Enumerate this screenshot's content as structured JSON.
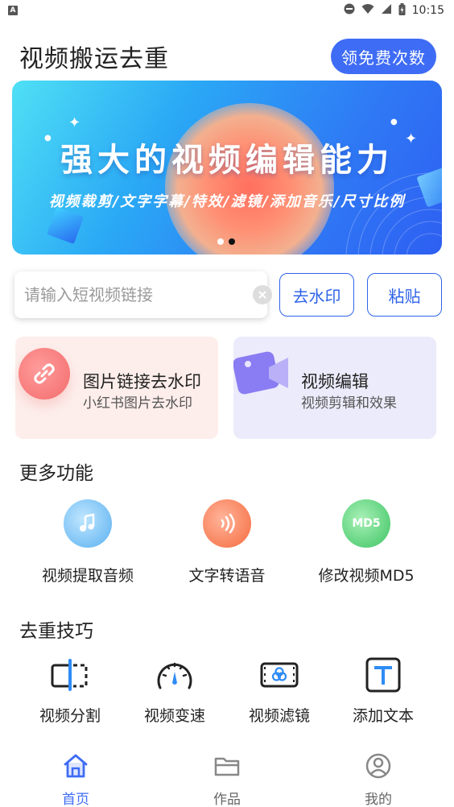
{
  "status_bar": {
    "left_icon": "A",
    "time": "10:15",
    "icons": [
      "dnd-icon",
      "wifi-icon",
      "signal-icon",
      "battery-icon"
    ]
  },
  "header": {
    "title": "视频搬运去重",
    "free_button": "领免费次数"
  },
  "banner": {
    "title": "强大的视频编辑能力",
    "subtitle": "视频裁剪/文字字幕/特效/滤镜/添加音乐/尺寸比例",
    "page_count": 2,
    "active_page": 2
  },
  "search": {
    "placeholder": "请输入短视频链接",
    "value": "",
    "watermark_button": "去水印",
    "paste_button": "粘贴"
  },
  "feature_cards": [
    {
      "title": "图片链接去水印",
      "subtitle": "小红书图片去水印",
      "icon": "link-icon"
    },
    {
      "title": "视频编辑",
      "subtitle": "视频剪辑和效果",
      "icon": "video-folder-icon"
    }
  ],
  "more_section": {
    "title": "更多功能",
    "items": [
      {
        "label": "视频提取音频",
        "icon": "music-icon"
      },
      {
        "label": "文字转语音",
        "icon": "sound-wave-icon"
      },
      {
        "label": "修改视频MD5",
        "icon": "md5-icon",
        "icon_text": "MD5"
      }
    ]
  },
  "tips_section": {
    "title": "去重技巧",
    "items": [
      {
        "label": "视频分割",
        "icon": "split-icon"
      },
      {
        "label": "视频变速",
        "icon": "speed-gauge-icon"
      },
      {
        "label": "视频滤镜",
        "icon": "filter-icon"
      },
      {
        "label": "添加文本",
        "icon": "text-icon",
        "icon_text": "T"
      }
    ]
  },
  "bottom_nav": [
    {
      "label": "首页",
      "icon": "home-icon",
      "active": true
    },
    {
      "label": "作品",
      "icon": "folder-icon",
      "active": false
    },
    {
      "label": "我的",
      "icon": "profile-icon",
      "active": false
    }
  ],
  "colors": {
    "accent": "#3f6cf5",
    "outline_blue": "#2f64e8",
    "card_pink_bg": "#fdeeeb",
    "card_purple_bg": "#ecebfb"
  }
}
